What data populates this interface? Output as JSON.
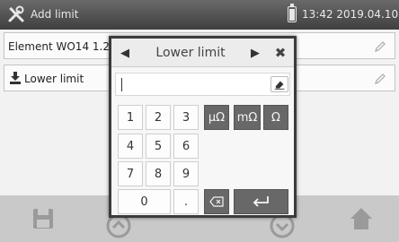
{
  "header": {
    "title": "Add limit",
    "datetime": "13:42 2019.04.10",
    "icon": "tools-icon"
  },
  "list": {
    "row1": "Element WO14 1.2",
    "row2": "Lower limit"
  },
  "dialog": {
    "title": "Lower limit",
    "input_value": "",
    "keys": {
      "k1": "1",
      "k2": "2",
      "k3": "3",
      "k4": "4",
      "k5": "5",
      "k6": "6",
      "k7": "7",
      "k8": "8",
      "k9": "9",
      "k0": "0",
      "dot": ".",
      "u_micro": "µΩ",
      "u_milli": "mΩ",
      "u_ohm": "Ω"
    }
  },
  "colors": {
    "header_bg": "#4f4f4f",
    "key_dark": "#686868",
    "modal_border": "#3b3b3b"
  }
}
